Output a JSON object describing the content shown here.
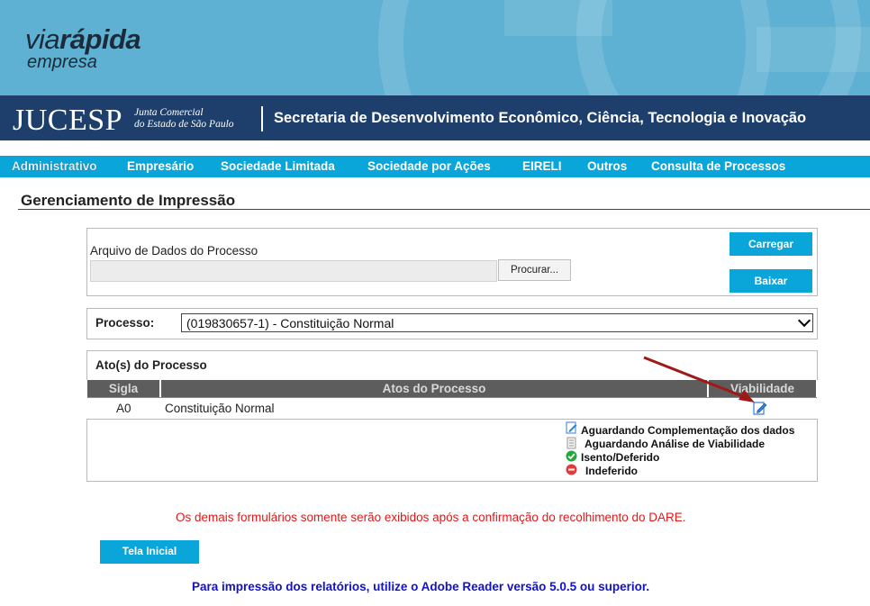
{
  "brand": {
    "via": "via",
    "rapida": "rápida",
    "empresa": "empresa"
  },
  "jucesp": {
    "name": "JUCESP",
    "subtitle_line1": "Junta Comercial",
    "subtitle_line2": "do Estado de São Paulo",
    "secretaria": "Secretaria de Desenvolvimento Econômico, Ciência, Tecnologia e Inovação"
  },
  "nav": [
    "Administrativo",
    "Empresário",
    "Sociedade Limitada",
    "Sociedade por Ações",
    "EIRELI",
    "Outros",
    "Consulta de Processos"
  ],
  "page_title": "Gerenciamento de Impressão",
  "upload": {
    "label": "Arquivo de Dados do Processo",
    "file_value": "",
    "browse_label": "Procurar...",
    "load_label": "Carregar",
    "download_label": "Baixar"
  },
  "processo": {
    "label": "Processo:",
    "selected": "(019830657-1) - Constituição Normal"
  },
  "atos": {
    "heading": "Ato(s) do Processo",
    "columns": [
      "Sigla",
      "Atos do Processo",
      "Viabilidade"
    ],
    "rows": [
      {
        "sigla": "A0",
        "ato": "Constituição Normal"
      }
    ]
  },
  "legend": [
    "Aguardando Complementação dos dados",
    "Aguardando Análise de Viabilidade",
    "Isento/Deferido",
    "Indeferido"
  ],
  "notice_red": "Os demais formulários somente serão exibidos após a confirmação do recolhimento do DARE.",
  "home_button": "Tela Inicial",
  "notice_blue": "Para impressão dos relatórios, utilize o Adobe Reader versão 5.0.5 ou superior.",
  "colors": {
    "nav": "#0aa6d9",
    "banner": "#5fb1d3",
    "jucesp_bar": "#1e3f6b",
    "button": "#0ba6d9",
    "header_row": "#5d5d5d",
    "warning": "#e01a1a",
    "info": "#1212c8"
  }
}
